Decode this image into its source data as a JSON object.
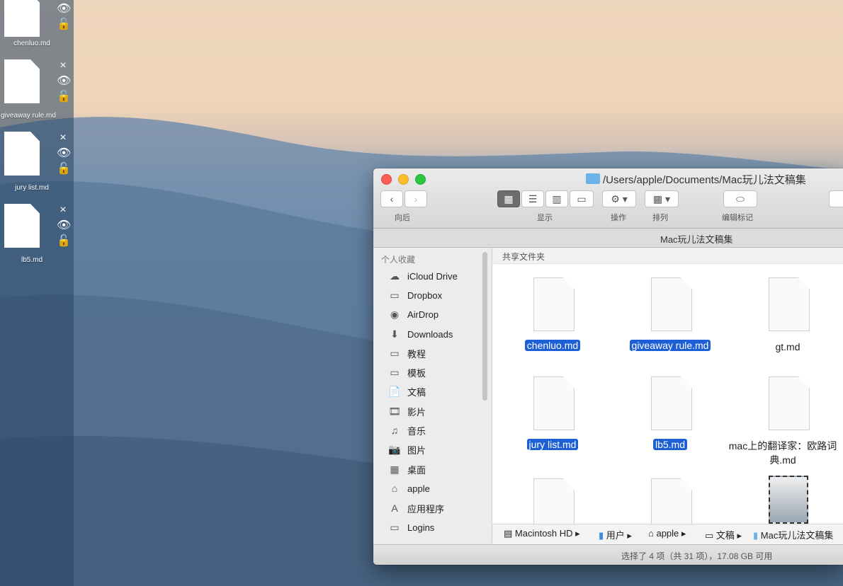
{
  "shelf": {
    "items": [
      {
        "name": "chenluo.md"
      },
      {
        "name": "giveaway rule.md"
      },
      {
        "name": "jury list.md"
      },
      {
        "name": "lb5.md"
      }
    ],
    "close_icon": "×",
    "eye_icon": "👁",
    "lock_icon": "🔓"
  },
  "finder": {
    "title": "/Users/apple/Documents/Mac玩儿法文稿集",
    "toolbar": {
      "back_forward_label": "向后",
      "view_label": "显示",
      "action_label": "操作",
      "arrange_label": "排列",
      "tag_label": "编辑标记"
    },
    "folder_name": "Mac玩儿法文稿集",
    "sidebar": {
      "heading": "个人收藏",
      "items": [
        {
          "label": "iCloud Drive",
          "icon": "☁"
        },
        {
          "label": "Dropbox",
          "icon": "▭"
        },
        {
          "label": "AirDrop",
          "icon": "◉"
        },
        {
          "label": "Downloads",
          "icon": "⬇"
        },
        {
          "label": "教程",
          "icon": "▭"
        },
        {
          "label": "模板",
          "icon": "▭"
        },
        {
          "label": "文稿",
          "icon": "📄"
        },
        {
          "label": "影片",
          "icon": "🎞"
        },
        {
          "label": "音乐",
          "icon": "♫"
        },
        {
          "label": "图片",
          "icon": "📷"
        },
        {
          "label": "桌面",
          "icon": "▦"
        },
        {
          "label": "apple",
          "icon": "⌂"
        },
        {
          "label": "应用程序",
          "icon": "A"
        },
        {
          "label": "Logins",
          "icon": "▭"
        }
      ]
    },
    "content_heading": "共享文件夹",
    "files": [
      {
        "name": "chenluo.md",
        "selected": true
      },
      {
        "name": "giveaway rule.md",
        "selected": true
      },
      {
        "name": "gt.md",
        "selected": false
      },
      {
        "name": "jury list.md",
        "selected": true
      },
      {
        "name": "lb5.md",
        "selected": true
      },
      {
        "name": "mac上的翻译家：欧路词典.md",
        "selected": false
      }
    ],
    "path": [
      "Macintosh HD",
      "用户",
      "apple",
      "文稿",
      "Mac玩儿法文稿集"
    ],
    "status": "选择了 4 项（共 31 项），17.08 GB 可用"
  }
}
